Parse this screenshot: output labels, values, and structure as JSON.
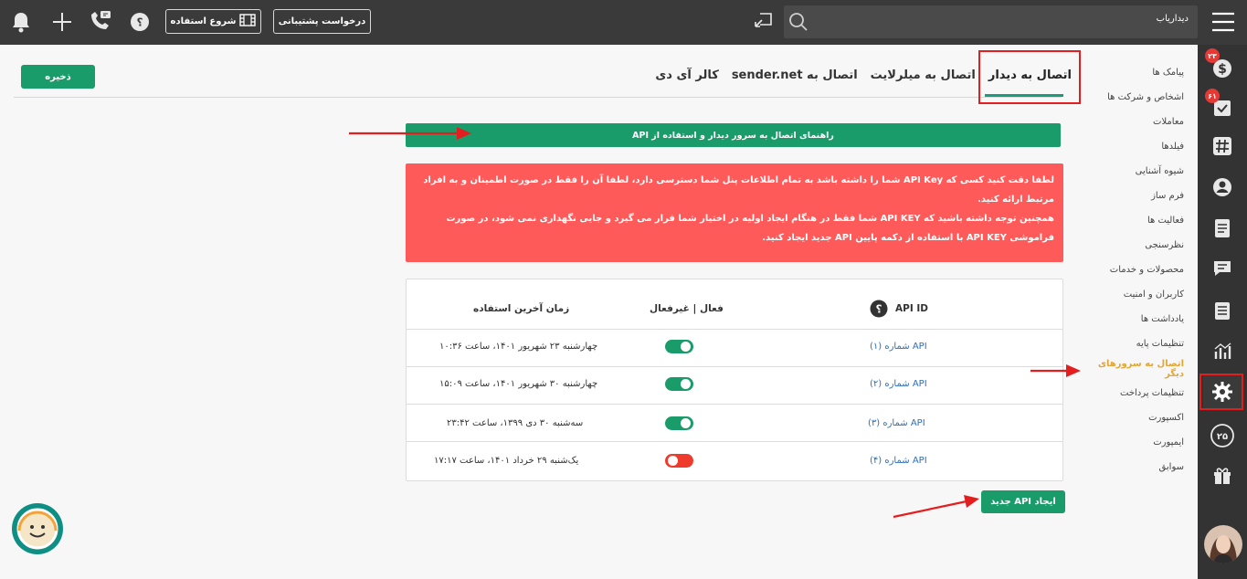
{
  "topbar": {
    "search_text": "دیداریاب",
    "support_label": "درخواست پشتیبانی",
    "start_label": "شروع استفاده"
  },
  "sidebar": {
    "badges": [
      "۲۳",
      "۶۱"
    ],
    "icons": [
      "dollar-icon",
      "check-icon",
      "hash-icon",
      "user-icon",
      "document-icon",
      "chat-icon",
      "clipboard-icon",
      "chart-icon",
      "gear-icon",
      "days-icon",
      "gift-icon",
      "avatar"
    ],
    "days_label": "۲۵"
  },
  "menu": {
    "items": [
      "پیامک ها",
      "اشخاص و شرکت ها",
      "معاملات",
      "فیلدها",
      "شیوه آشنایی",
      "فرم ساز",
      "فعالیت ها",
      "نظرسنجی",
      "محصولات و خدمات",
      "کاربران و امنیت",
      "یادداشت ها",
      "تنظیمات پایه",
      "اتصال به سرورهای دیگر",
      "تنظیمات پرداخت",
      "اکسپورت",
      "ایمپورت",
      "سوابق"
    ],
    "active_index": 12
  },
  "tabs": [
    "اتصال به دیدار",
    "اتصال به میلرلایت",
    "اتصال به sender.net",
    "کالر آی دی"
  ],
  "save_label": "ذخیره",
  "guide_label": "راهنمای اتصال به سرور دیدار و استفاده از API",
  "alert": {
    "line1": "لطفا دقت کنید کسی که API Key شما را داشته باشد به تمام اطلاعات پنل شما دسترسی دارد، لطفا آن را فقط در صورت اطمینان و به افراد مرتبط ارائه کنید.",
    "line2": "همچنین توجه داشته باشید که API KEY شما فقط در هنگام ایجاد اولیه در اختیار شما قرار می گیرد و جایی نگهداری نمی شود، در صورت فراموشی API KEY با استفاده از دکمه پایین API جدید ایجاد کنید."
  },
  "table": {
    "headers": {
      "api_id": "API ID",
      "status": "فعال | غیرفعال",
      "last_used": "زمان آخرین استفاده"
    },
    "rows": [
      {
        "name": "API شماره (۱)",
        "active": true,
        "last_used": "چهارشنبه ۲۳ شهریور ۱۴۰۱، ساعت ۱۰:۳۶"
      },
      {
        "name": "API شماره (۲)",
        "active": true,
        "last_used": "چهارشنبه ۳۰ شهریور ۱۴۰۱، ساعت ۱۵:۰۹"
      },
      {
        "name": "API شماره (۳)",
        "active": true,
        "last_used": "سه‌شنبه ۳۰ دی ۱۳۹۹، ساعت ۲۳:۴۲"
      },
      {
        "name": "API شماره (۴)",
        "active": false,
        "last_used": "یک‌شنبه ۲۹ خرداد ۱۴۰۱، ساعت ۱۷:۱۷"
      }
    ]
  },
  "new_api_label": "ایجاد API جدید",
  "colors": {
    "green": "#1a9c6a",
    "red_alert": "#ff5a5a",
    "active_menu": "#e3a534",
    "annotation": "#e41e1e"
  }
}
